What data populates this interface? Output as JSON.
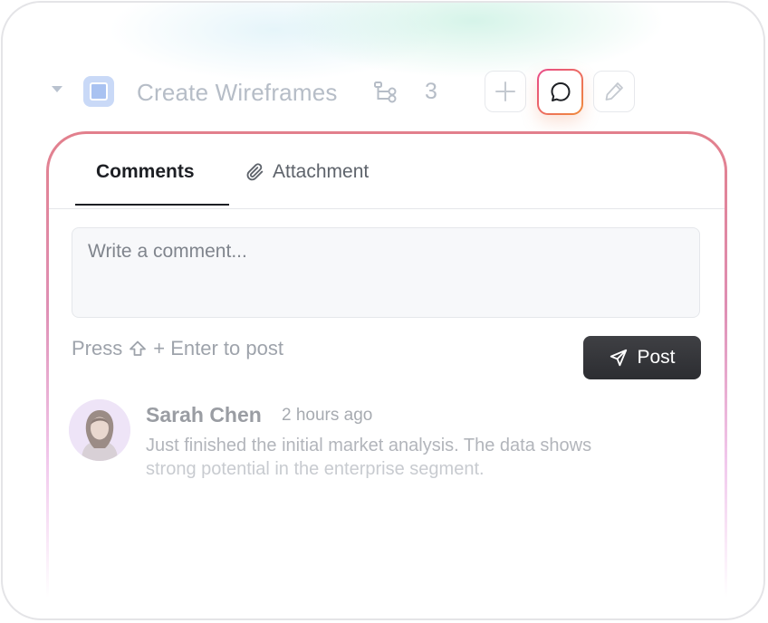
{
  "task": {
    "title": "Create Wireframes",
    "subtask_count": "3"
  },
  "tabs": {
    "comments": "Comments",
    "attachment": "Attachment"
  },
  "comment_box": {
    "placeholder": "Write a comment...",
    "hint_prefix": "Press",
    "hint_suffix": "+ Enter to post",
    "post_label": "Post"
  },
  "comments": [
    {
      "author": "Sarah Chen",
      "time": "2 hours ago",
      "line1": "Just finished the initial market analysis. The data shows",
      "line2": "strong potential in the enterprise segment."
    }
  ],
  "colors": {
    "accent_gradient_start": "#e84a8a",
    "accent_gradient_end": "#f08b3a",
    "post_button": "#333438"
  }
}
